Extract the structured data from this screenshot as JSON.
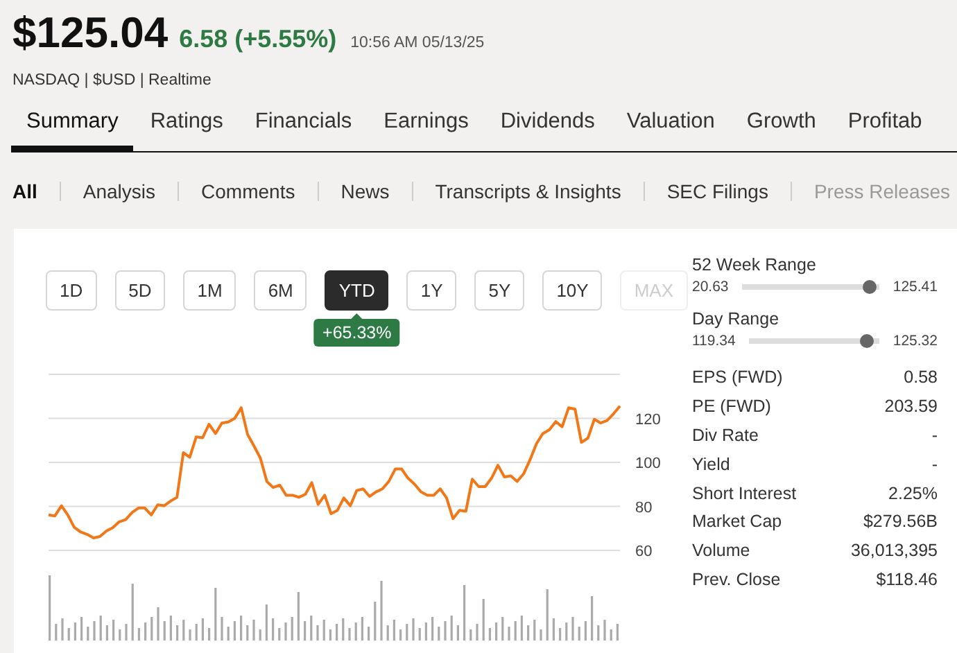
{
  "quote": {
    "price": "$125.04",
    "change": "6.58 (+5.55%)",
    "timestamp": "10:56 AM 05/13/25",
    "meta": "NASDAQ | $USD | Realtime"
  },
  "tabs": [
    {
      "label": "Summary",
      "selected": true
    },
    {
      "label": "Ratings",
      "selected": false
    },
    {
      "label": "Financials",
      "selected": false
    },
    {
      "label": "Earnings",
      "selected": false
    },
    {
      "label": "Dividends",
      "selected": false
    },
    {
      "label": "Valuation",
      "selected": false
    },
    {
      "label": "Growth",
      "selected": false
    },
    {
      "label": "Profitab",
      "selected": false
    }
  ],
  "subtabs": [
    {
      "label": "All",
      "selected": true,
      "disabled": false
    },
    {
      "label": "Analysis",
      "selected": false,
      "disabled": false
    },
    {
      "label": "Comments",
      "selected": false,
      "disabled": false
    },
    {
      "label": "News",
      "selected": false,
      "disabled": false
    },
    {
      "label": "Transcripts & Insights",
      "selected": false,
      "disabled": false
    },
    {
      "label": "SEC Filings",
      "selected": false,
      "disabled": false
    },
    {
      "label": "Press Releases",
      "selected": false,
      "disabled": true
    }
  ],
  "periods": [
    {
      "label": "1D",
      "selected": false,
      "disabled": false
    },
    {
      "label": "5D",
      "selected": false,
      "disabled": false
    },
    {
      "label": "1M",
      "selected": false,
      "disabled": false
    },
    {
      "label": "6M",
      "selected": false,
      "disabled": false
    },
    {
      "label": "YTD",
      "selected": true,
      "disabled": false
    },
    {
      "label": "1Y",
      "selected": false,
      "disabled": false
    },
    {
      "label": "5Y",
      "selected": false,
      "disabled": false
    },
    {
      "label": "10Y",
      "selected": false,
      "disabled": false
    },
    {
      "label": "MAX",
      "selected": false,
      "disabled": true
    }
  ],
  "period_return": "+65.33%",
  "chart": {
    "chart_data": {
      "type": "line",
      "grid": true,
      "ylim": [
        60,
        140
      ],
      "yticks": [
        60,
        80,
        100,
        120
      ],
      "series": [
        {
          "color": "#f07818",
          "values": [
            76.1,
            75.7,
            80.3,
            76.1,
            70.5,
            68.4,
            67.3,
            65.7,
            66.3,
            68.8,
            70.3,
            73.0,
            74.0,
            77.2,
            79.3,
            79.3,
            76.1,
            80.7,
            80.3,
            82.4,
            84.1,
            104.4,
            102.3,
            111.6,
            111.2,
            117.3,
            113.1,
            117.9,
            118.3,
            120,
            124.8,
            112.7,
            107.5,
            101.8,
            91.3,
            88.6,
            89.7,
            85.1,
            85.1,
            84.1,
            85.5,
            90.8,
            80.9,
            85.1,
            76.7,
            78.2,
            83.8,
            80.3,
            87.2,
            88.0,
            84.5,
            86.6,
            88.0,
            91.3,
            97.0,
            97.0,
            92.8,
            90.1,
            86.6,
            85.1,
            85.1,
            88.0,
            83.8,
            74.4,
            78.2,
            77.8,
            92.4,
            89.0,
            89.0,
            92.8,
            98.7,
            93.4,
            93.8,
            91.3,
            94.9,
            101.2,
            108.5,
            113.1,
            114.8,
            118.5,
            116.2,
            124.8,
            124.2,
            109.1,
            111.0,
            119.6,
            117.9,
            119.0,
            122.1,
            125.6
          ]
        }
      ]
    }
  },
  "ranges": [
    {
      "label": "52 Week Range",
      "low": "20.63",
      "high": "125.41",
      "level": 0.93
    },
    {
      "label": "Day Range",
      "low": "119.34",
      "high": "125.32",
      "level": 0.91
    }
  ],
  "stats": [
    {
      "label": "EPS (FWD)",
      "value": "0.58"
    },
    {
      "label": "PE (FWD)",
      "value": "203.59"
    },
    {
      "label": "Div Rate",
      "value": "-"
    },
    {
      "label": "Yield",
      "value": "-"
    },
    {
      "label": "Short Interest",
      "value": "2.25%"
    },
    {
      "label": "Market Cap",
      "value": "$279.56B"
    },
    {
      "label": "Volume",
      "value": "36,013,395"
    },
    {
      "label": "Prev. Close",
      "value": "$118.46"
    }
  ]
}
